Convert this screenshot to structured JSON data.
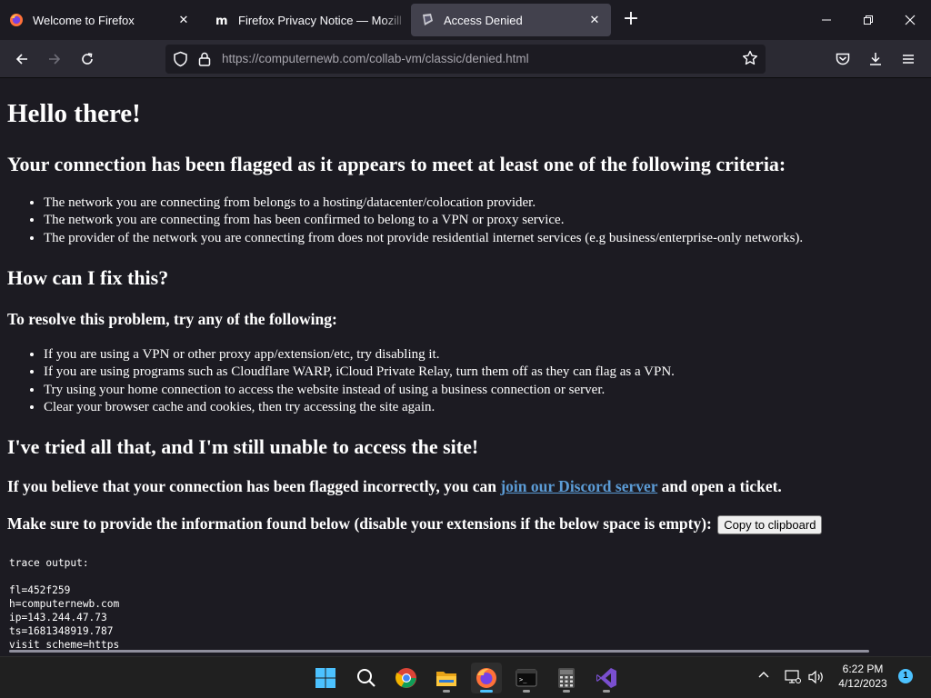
{
  "browser": {
    "tabs": [
      {
        "label": "Welcome to Firefox",
        "icon": "firefox-icon"
      },
      {
        "label": "Firefox Privacy Notice — Mozill",
        "icon": "mozilla-m-icon"
      },
      {
        "label": "Access Denied",
        "icon": "vm-logo-icon"
      }
    ],
    "url_host": "https://computernewb.com",
    "url_path": "/collab-vm/classic/denied.html"
  },
  "page": {
    "heading": "Hello there!",
    "flagged_heading": "Your connection has been flagged as it appears to meet at least one of the following criteria:",
    "criteria": [
      "The network you are connecting from belongs to a hosting/datacenter/colocation provider.",
      "The network you are connecting from has been confirmed to belong to a VPN or proxy service.",
      "The provider of the network you are connecting from does not provide residential internet services (e.g business/enterprise-only networks)."
    ],
    "fix_heading": "How can I fix this?",
    "resolve_heading": "To resolve this problem, try any of the following:",
    "fixes": [
      "If you are using a VPN or other proxy app/extension/etc, try disabling it.",
      "If you are using programs such as Cloudflare WARP, iCloud Private Relay, turn them off as they can flag as a VPN.",
      "Try using your home connection to access the website instead of using a business connection or server.",
      "Clear your browser cache and cookies, then try accessing the site again."
    ],
    "tried_heading": "I've tried all that, and I'm still unable to access the site!",
    "incorrect_prefix": "If you believe that your connection has been flagged incorrectly, you can ",
    "discord_link": "join our Discord server",
    "incorrect_suffix": " and open a ticket.",
    "provide_info": "Make sure to provide the information found below (disable your extensions if the below space is empty):",
    "copy_button": "Copy to clipboard",
    "trace_label": "trace output:",
    "trace_lines": [
      "fl=452f259",
      "h=computernewb.com",
      "ip=143.244.47.73",
      "ts=1681348919.787",
      "visit_scheme=https"
    ]
  },
  "taskbar": {
    "apps": [
      "windows-start-icon",
      "search-icon",
      "chrome-icon",
      "file-explorer-icon",
      "firefox-icon",
      "terminal-icon",
      "calculator-icon",
      "visual-studio-icon"
    ],
    "time": "6:22 PM",
    "date": "4/12/2023",
    "notification_count": "1"
  },
  "colors": {
    "page_bg": "#1c1b22",
    "link": "#5b9bd5",
    "accent": "#4cc2ff"
  }
}
